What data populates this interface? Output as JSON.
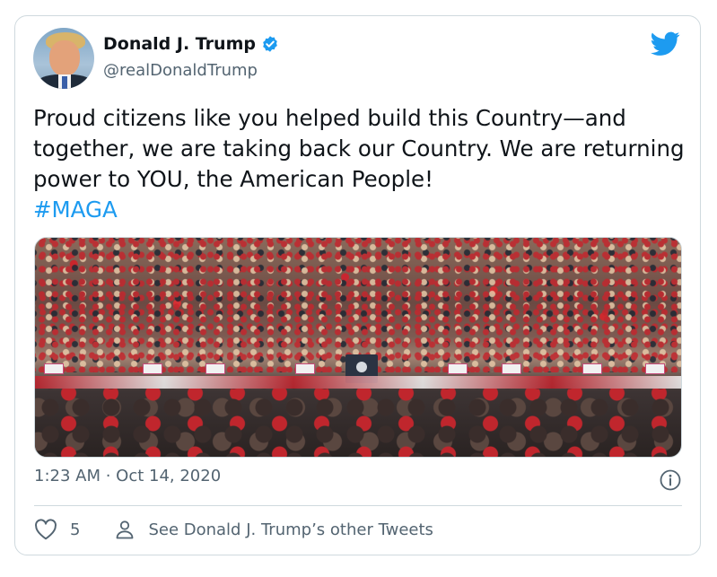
{
  "author": {
    "name": "Donald J. Trump",
    "handle": "@realDonaldTrump",
    "verified": true
  },
  "icons": {
    "avatar": "profile-photo",
    "verified": "verified-badge-icon",
    "brand": "twitter-bird-icon",
    "info": "info-icon",
    "like": "heart-icon",
    "profile": "person-icon"
  },
  "tweet": {
    "text": "Proud citizens like you helped build this Country—and together, we are taking back our Country. We are returning power to YOU, the American People!",
    "hashtag": "#MAGA"
  },
  "timestamp": "1:23 AM · Oct 14, 2020",
  "actions": {
    "like_count": "5",
    "other_tweets_label": "See Donald J. Trump’s other Tweets"
  },
  "colors": {
    "brand_blue": "#1d9bf0",
    "text_primary": "#0f1419",
    "text_secondary": "#536471",
    "border": "#cfd9de"
  }
}
